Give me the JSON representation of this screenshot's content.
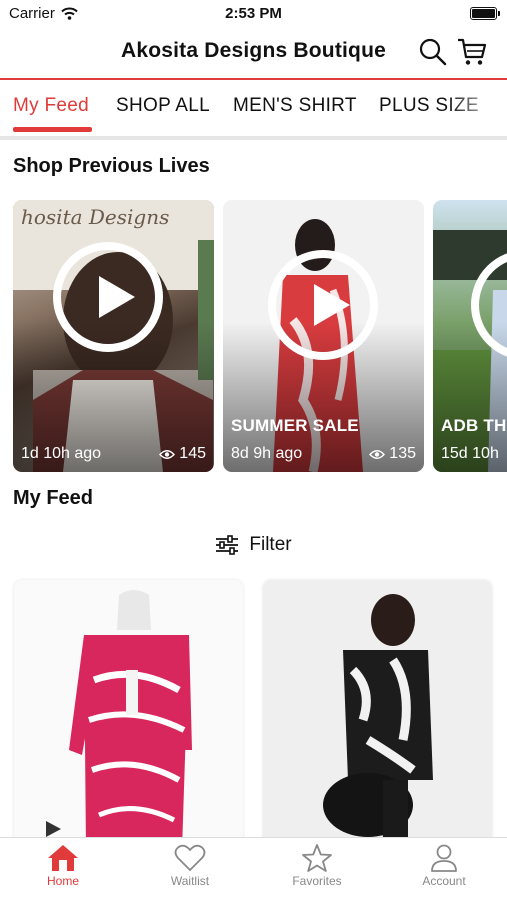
{
  "status": {
    "carrier": "Carrier",
    "time": "2:53 PM"
  },
  "header": {
    "title": "Akosita Designs Boutique"
  },
  "tabs": [
    {
      "label": "My Feed",
      "active": true
    },
    {
      "label": "SHOP ALL",
      "active": false
    },
    {
      "label": "MEN'S SHIRT",
      "active": false
    },
    {
      "label": "PLUS SIZE",
      "active": false
    }
  ],
  "lives": {
    "title": "Shop Previous Lives",
    "items": [
      {
        "label": "",
        "ago": "1d 10h ago",
        "views": "145"
      },
      {
        "label": "SUMMER SALE",
        "ago": "8d 9h ago",
        "views": "135"
      },
      {
        "label": "ADB THU",
        "ago": "15d 10h",
        "views": ""
      }
    ]
  },
  "feed": {
    "title": "My Feed",
    "filter_label": "Filter"
  },
  "tabbar": [
    {
      "label": "Home",
      "icon": "home-icon",
      "active": true
    },
    {
      "label": "Waitlist",
      "icon": "heart-icon",
      "active": false
    },
    {
      "label": "Favorites",
      "icon": "star-icon",
      "active": false
    },
    {
      "label": "Account",
      "icon": "person-icon",
      "active": false
    }
  ],
  "colors": {
    "accent": "#e03a3a",
    "inactive": "#888888"
  }
}
